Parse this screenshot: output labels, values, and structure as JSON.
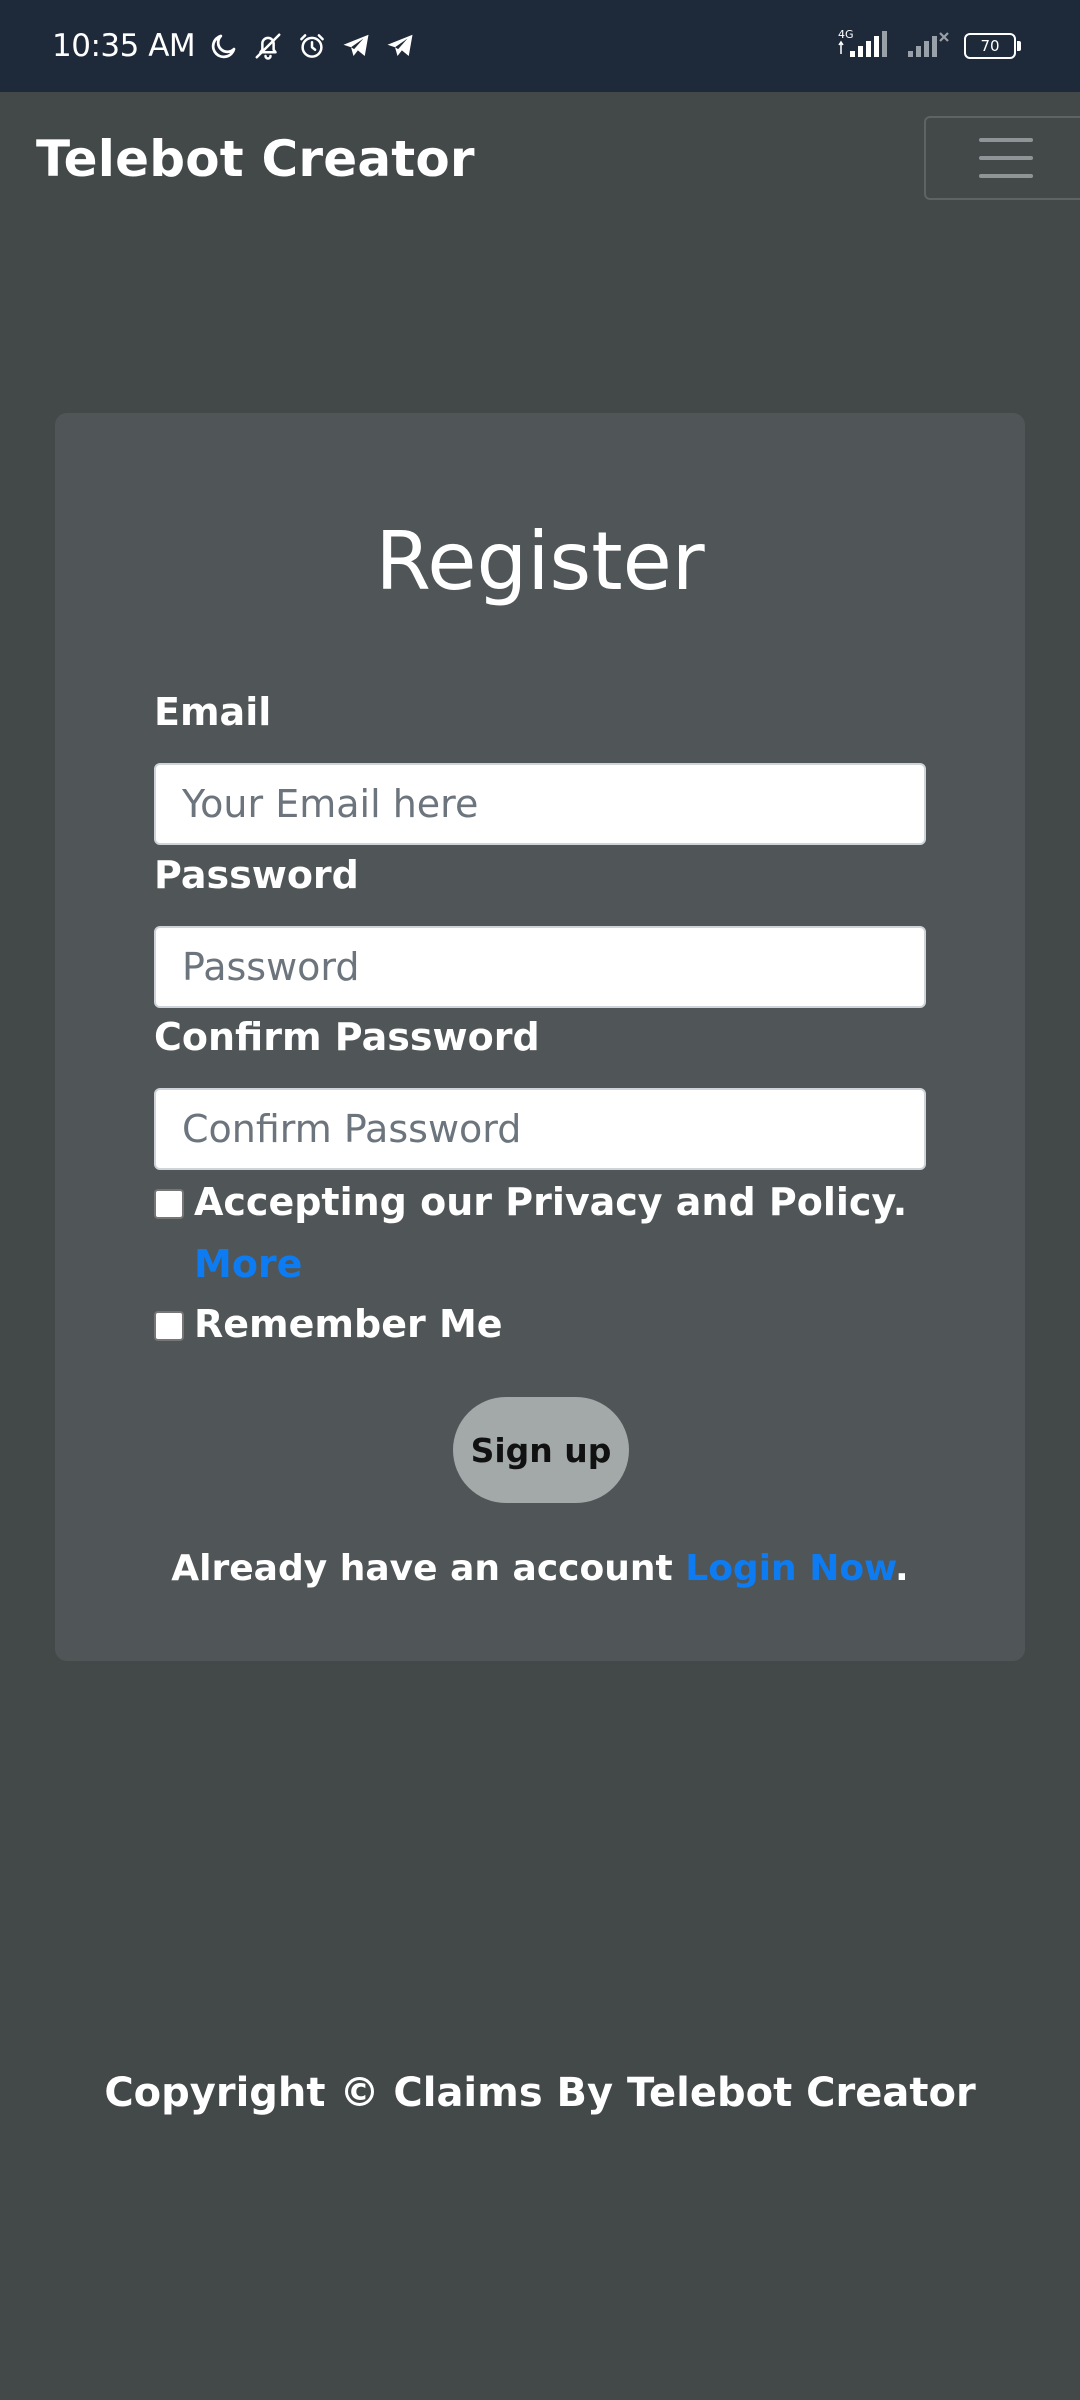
{
  "status_bar": {
    "time": "10:35 AM",
    "left_icons": [
      "moon-icon",
      "bell-off-icon",
      "alarm-icon",
      "telegram-icon",
      "telegram-icon"
    ],
    "network_label": "4G",
    "battery_level": "70"
  },
  "navbar": {
    "brand": "Telebot Creator",
    "menu_icon": "hamburger-icon"
  },
  "form": {
    "title": "Register",
    "email_label": "Email",
    "email_placeholder": "Your Email here",
    "password_label": "Password",
    "password_placeholder": "Password",
    "confirm_label": "Confirm Password",
    "confirm_placeholder": "Confirm Password",
    "privacy_text": "Accepting our Privacy and Policy.",
    "privacy_link": "More",
    "remember_text": "Remember Me",
    "signup_button": "Sign up",
    "login_prompt": "Already have an account",
    "login_link": "Login Now",
    "login_suffix": "."
  },
  "footer": {
    "copyright": "Copyright © Claims By Telebot Creator"
  },
  "colors": {
    "status_bar_bg": "#1e293a",
    "page_bg": "#434849",
    "card_bg": "#505657",
    "link": "#0d7cf2",
    "button_bg": "#a3a8a9"
  }
}
